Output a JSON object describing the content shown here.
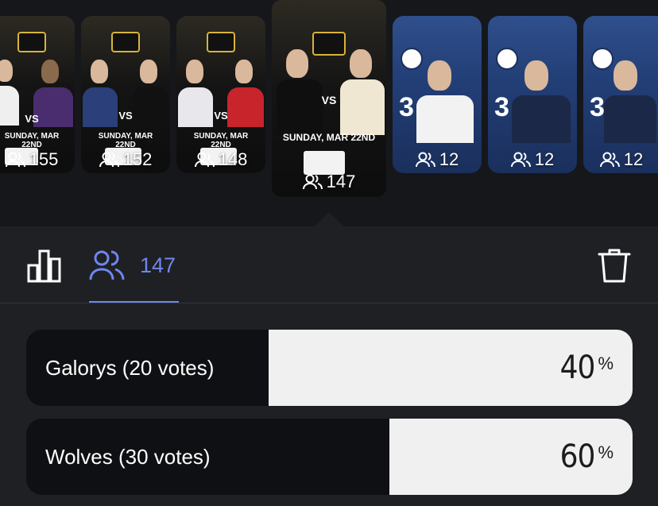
{
  "stories": [
    {
      "id": "story-1",
      "count": "155",
      "style": "dark",
      "date": "SUNDAY, MAR 22ND"
    },
    {
      "id": "story-2",
      "count": "152",
      "style": "dark",
      "date": "SUNDAY, MAR 22ND"
    },
    {
      "id": "story-3",
      "count": "148",
      "style": "dark",
      "date": "SUNDAY, MAR 22ND"
    },
    {
      "id": "story-4",
      "count": "147",
      "style": "dark",
      "date": "SUNDAY, MAR 22ND",
      "selected": true
    },
    {
      "id": "story-5",
      "count": "12",
      "style": "blue",
      "score": "3"
    },
    {
      "id": "story-6",
      "count": "12",
      "style": "blue",
      "score": "3"
    },
    {
      "id": "story-7",
      "count": "12",
      "style": "blue",
      "score": "3"
    }
  ],
  "toolbar": {
    "viewers_count": "147",
    "accent_color": "#6f86f0",
    "icons": [
      "bar-chart-icon",
      "viewers-icon",
      "trash-icon"
    ]
  },
  "poll": {
    "options": [
      {
        "label": "Galorys (20 votes)",
        "percent_value": "40",
        "percent_sign": "%",
        "share": 0.4
      },
      {
        "label": "Wolves (30 votes)",
        "percent_value": "60",
        "percent_sign": "%",
        "share": 0.6
      }
    ]
  }
}
